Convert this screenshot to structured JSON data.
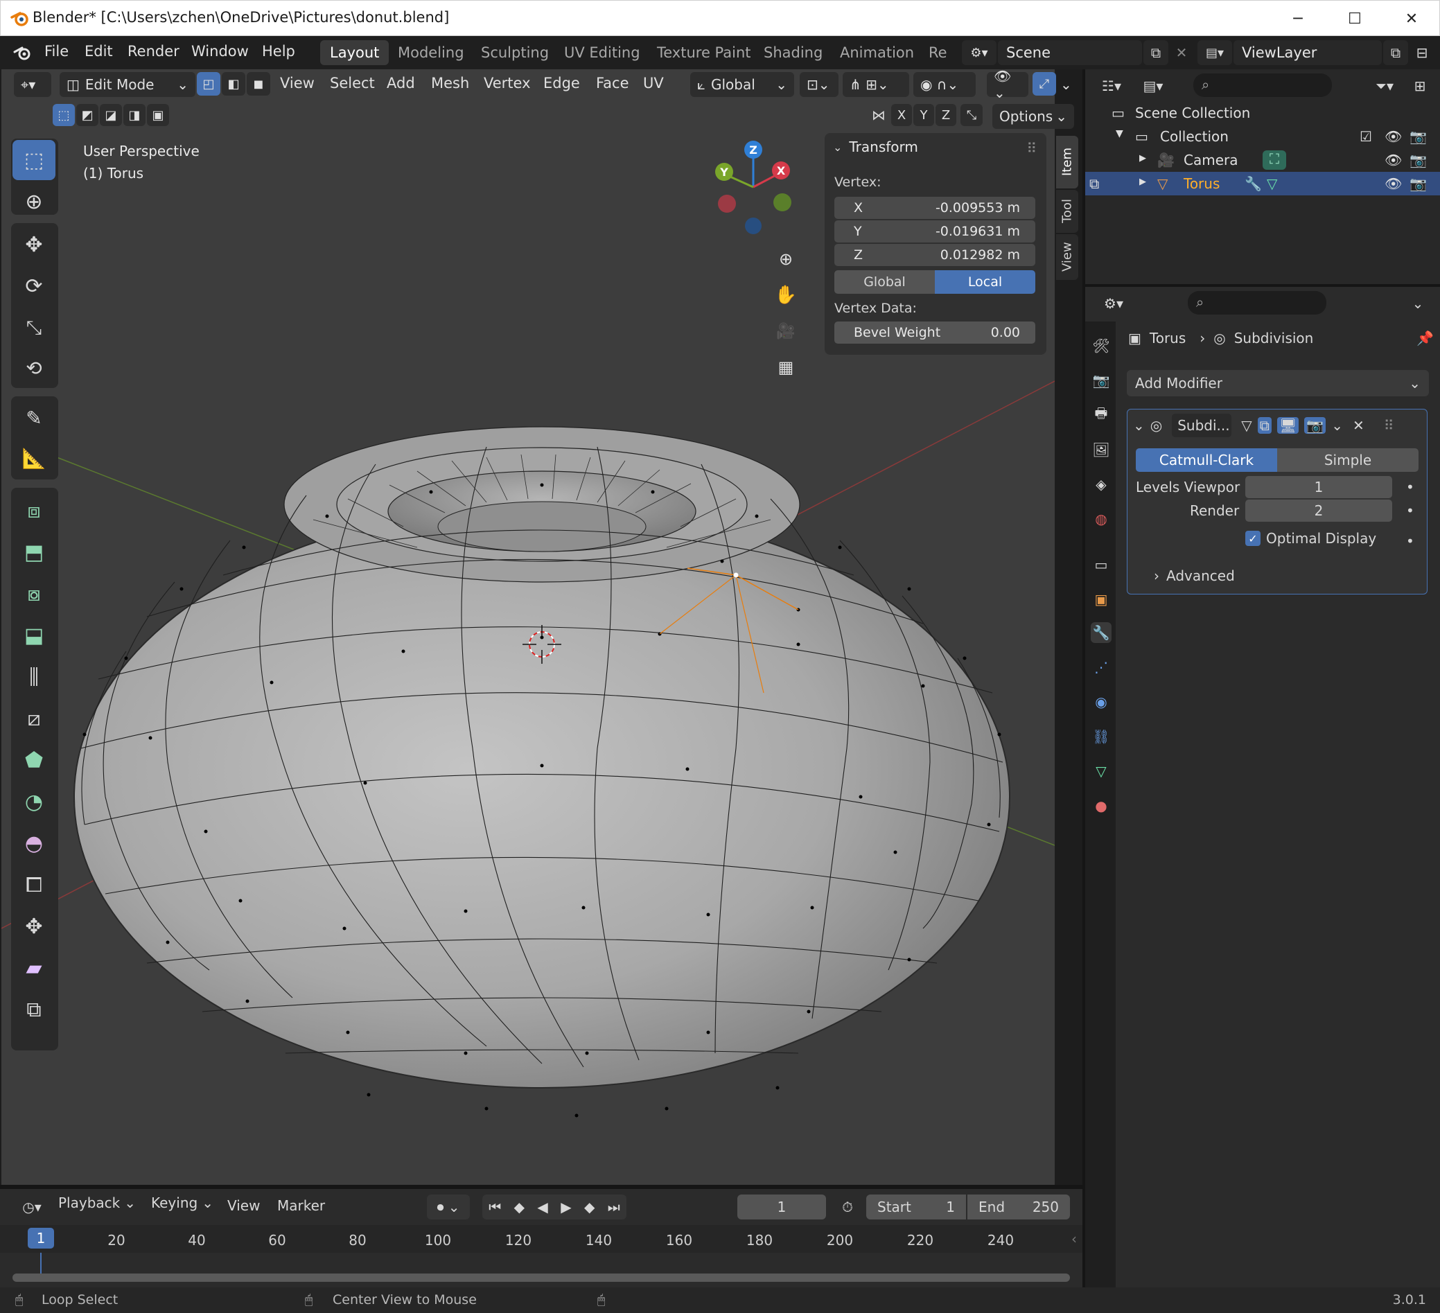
{
  "window": {
    "title": "Blender* [C:\\Users\\zchen\\OneDrive\\Pictures\\donut.blend]",
    "minimize": "─",
    "maximize": "☐",
    "close": "✕"
  },
  "menubar": {
    "items": [
      "File",
      "Edit",
      "Render",
      "Window",
      "Help"
    ],
    "workspaces": [
      "Layout",
      "Modeling",
      "Sculpting",
      "UV Editing",
      "Texture Paint",
      "Shading",
      "Animation",
      "Re"
    ],
    "active_workspace": "Layout",
    "scene": "Scene",
    "view_layer": "ViewLayer"
  },
  "viewport_header": {
    "mode": "Edit Mode",
    "menus": [
      "View",
      "Select",
      "Add",
      "Mesh",
      "Vertex",
      "Edge",
      "Face",
      "UV"
    ],
    "orientation": "Global",
    "axes": [
      "X",
      "Y",
      "Z"
    ],
    "options": "Options"
  },
  "viewport": {
    "view_name": "User Perspective",
    "object_name": "(1) Torus",
    "gizmo_axes": {
      "x": "X",
      "y": "Y",
      "z": "Z"
    }
  },
  "npanel": {
    "section": "Transform",
    "vertex_label": "Vertex:",
    "x_label": "X",
    "x_value": "-0.009553 m",
    "y_label": "Y",
    "y_value": "-0.019631 m",
    "z_label": "Z",
    "z_value": "0.012982 m",
    "global": "Global",
    "local": "Local",
    "vertex_data_label": "Vertex Data:",
    "bevel_label": "Bevel Weight",
    "bevel_value": "0.00",
    "tabs": [
      "Item",
      "Tool",
      "View"
    ]
  },
  "outliner": {
    "scene_collection": "Scene Collection",
    "collection": "Collection",
    "camera": "Camera",
    "torus": "Torus"
  },
  "properties": {
    "breadcrumb_object": "Torus",
    "breadcrumb_modifier": "Subdivision",
    "add_modifier": "Add Modifier",
    "modifier_name": "Subdi...",
    "catmull": "Catmull-Clark",
    "simple": "Simple",
    "levels_viewport_label": "Levels Viewpor",
    "levels_viewport_value": "1",
    "render_label": "Render",
    "render_value": "2",
    "optimal_display": "Optimal Display",
    "advanced": "Advanced"
  },
  "timeline": {
    "menus": [
      "Playback",
      "Keying",
      "View",
      "Marker"
    ],
    "current_frame": "1",
    "start_label": "Start",
    "start_value": "1",
    "end_label": "End",
    "end_value": "250",
    "playhead": "1",
    "ticks": [
      "20",
      "40",
      "60",
      "80",
      "100",
      "120",
      "140",
      "160",
      "180",
      "200",
      "220",
      "240"
    ]
  },
  "statusbar": {
    "left_action": "Loop Select",
    "middle_action": "Center View to Mouse",
    "version": "3.0.1"
  },
  "colors": {
    "accent": "#4772b3",
    "viewport_bg": "#3d3d3d",
    "selected_text": "#ffaf29"
  }
}
